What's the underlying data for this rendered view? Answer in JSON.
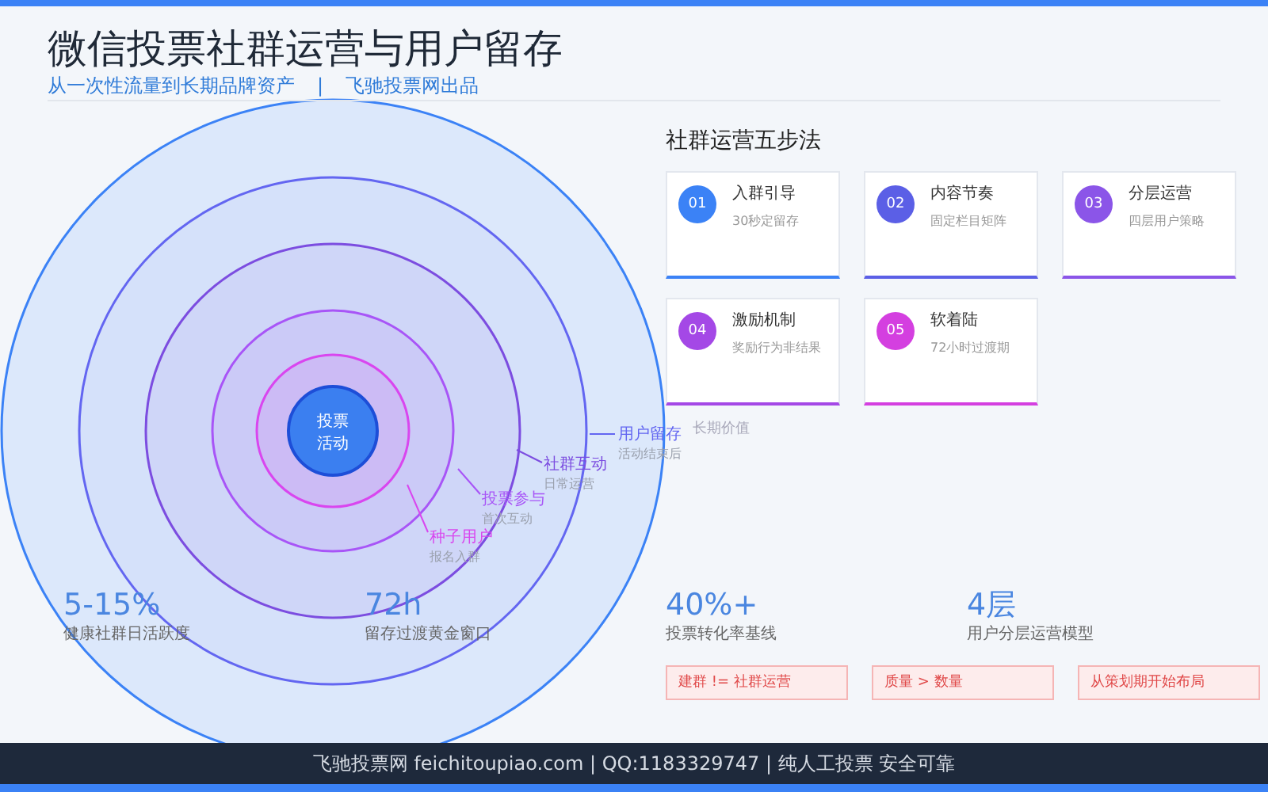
{
  "header": {
    "title": "微信投票社群运营与用户留存",
    "subtitle": "从一次性流量到长期品牌资产",
    "separator": "|",
    "brand": "飞驰投票网出品"
  },
  "diagram": {
    "center": [
      "投票",
      "活动"
    ],
    "rings": [
      {
        "label": "用户留存",
        "sublabel": "活动结束后",
        "color": "#6366f1"
      },
      {
        "label": "社群互动",
        "sublabel": "日常运营",
        "color": "#7c4de0"
      },
      {
        "label": "投票参与",
        "sublabel": "首次互动",
        "color": "#a855f7"
      },
      {
        "label": "种子用户",
        "sublabel": "报名入群",
        "color": "#d946ef"
      }
    ],
    "hidden_label": "长期价值"
  },
  "steps": {
    "title": "社群运营五步法",
    "cards": [
      {
        "number": "01",
        "title": "入群引导",
        "desc": "30秒定留存",
        "color": "#3b82f6"
      },
      {
        "number": "02",
        "title": "内容节奏",
        "desc": "固定栏目矩阵",
        "color": "#5b5fe6"
      },
      {
        "number": "03",
        "title": "分层运营",
        "desc": "四层用户策略",
        "color": "#8b55e8"
      },
      {
        "number": "04",
        "title": "激励机制",
        "desc": "奖励行为非结果",
        "color": "#a448e6"
      },
      {
        "number": "05",
        "title": "软着陆",
        "desc": "72小时过渡期",
        "color": "#d43fe0"
      }
    ]
  },
  "stats": [
    {
      "value": "5-15%",
      "label": "健康社群日活跃度"
    },
    {
      "value": "72h",
      "label": "留存过渡黄金窗口"
    },
    {
      "value": "40%+",
      "label": "投票转化率基线"
    },
    {
      "value": "4层",
      "label": "用户分层运营模型"
    }
  ],
  "tags": [
    "建群 != 社群运营",
    "质量 > 数量",
    "从策划期开始布局"
  ],
  "footer": "飞驰投票网 feichitoupiao.com | QQ:1183329747 | 纯人工投票 安全可靠"
}
